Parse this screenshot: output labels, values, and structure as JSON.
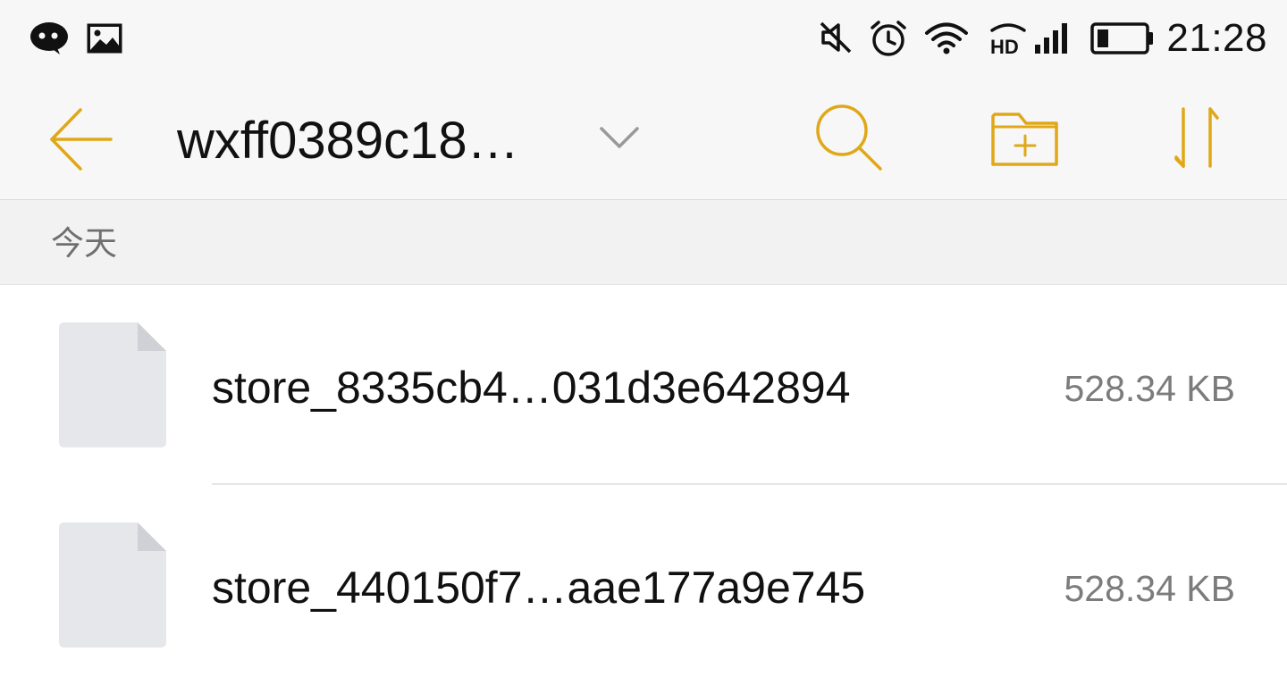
{
  "status_bar": {
    "left_icons": [
      "wechat-icon",
      "image-icon"
    ],
    "right_icons": [
      "mute-icon",
      "alarm-icon",
      "wifi-icon",
      "hd-signal-icon",
      "battery-icon"
    ],
    "time": "21:28",
    "battery_level": 0.2
  },
  "header": {
    "back_icon": "arrow-left-icon",
    "title": "wxff0389c18…",
    "dropdown_icon": "chevron-down-icon",
    "actions": [
      "search-icon",
      "new-folder-icon",
      "sort-icon"
    ]
  },
  "section": {
    "label": "今天"
  },
  "files": [
    {
      "name": "store_8335cb4…031d3e642894",
      "size": "528.34 KB",
      "icon": "file-icon"
    },
    {
      "name": "store_440150f7…aae177a9e745",
      "size": "528.34 KB",
      "icon": "file-icon"
    }
  ],
  "colors": {
    "accent": "#e0a818",
    "bar_bg": "#f7f7f7",
    "section_bg": "#f2f2f2",
    "file_icon": "#e6e7eb",
    "secondary_text": "#7c7c7c"
  }
}
